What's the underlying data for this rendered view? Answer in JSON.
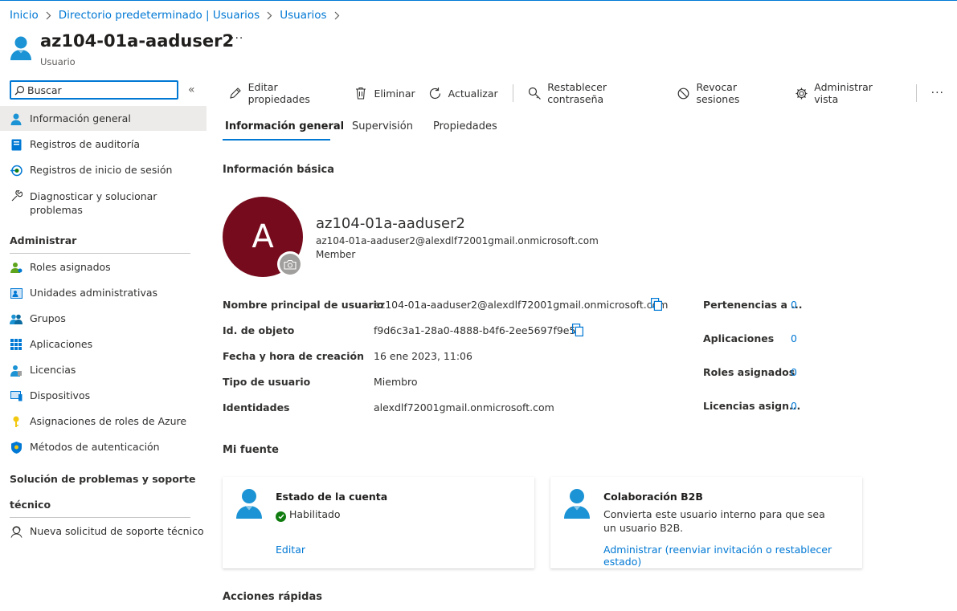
{
  "breadcrumb": {
    "items": [
      "Inicio",
      "Directorio predeterminado | Usuarios",
      "Usuarios"
    ]
  },
  "header": {
    "title": "az104-01a-aaduser2",
    "subtitle": "Usuario",
    "more_label": "···"
  },
  "sidebar": {
    "search_placeholder": "Buscar",
    "collapse_label": "«",
    "top_items": [
      {
        "label": "Información general",
        "icon": "user-icon"
      },
      {
        "label": "Registros de auditoría",
        "icon": "audit-log-icon"
      },
      {
        "label": "Registros de inicio de sesión",
        "icon": "sign-in-log-icon"
      },
      {
        "label": "Diagnosticar y solucionar problemas",
        "icon": "wrench-icon"
      }
    ],
    "section_manage": "Administrar",
    "manage_items": [
      {
        "label": "Roles asignados",
        "icon": "assigned-roles-icon"
      },
      {
        "label": "Unidades administrativas",
        "icon": "admin-units-icon"
      },
      {
        "label": "Grupos",
        "icon": "groups-icon"
      },
      {
        "label": "Aplicaciones",
        "icon": "applications-icon"
      },
      {
        "label": "Licencias",
        "icon": "licenses-icon"
      },
      {
        "label": "Dispositivos",
        "icon": "devices-icon"
      },
      {
        "label": "Asignaciones de roles de Azure",
        "icon": "key-icon"
      },
      {
        "label": "Métodos de autenticación",
        "icon": "shield-icon"
      }
    ],
    "section_support_line1": "Solución de problemas y soporte",
    "section_support_line2": "técnico",
    "support_items": [
      {
        "label": "Nueva solicitud de soporte técnico",
        "icon": "support-person-icon"
      }
    ]
  },
  "toolbar": {
    "edit_label": "Editar propiedades",
    "delete_label": "Eliminar",
    "refresh_label": "Actualizar",
    "reset_password_label": "Restablecer contraseña",
    "revoke_label": "Revocar sesiones",
    "manage_view_label": "Administrar vista",
    "more_label": "···"
  },
  "tabs": [
    "Información general",
    "Supervisión",
    "Propiedades"
  ],
  "basic_info": {
    "section_title": "Información básica",
    "avatar_initial": "A",
    "avatar_color": "#750b1c",
    "display_name": "az104-01a-aaduser2",
    "upn": "az104-01a-aaduser2@alexdlf72001gmail.onmicrosoft.com",
    "member_type": "Member"
  },
  "properties": [
    {
      "label": "Nombre principal de usuario",
      "value": "az104-01a-aaduser2@alexdlf72001gmail.onmicrosoft.com"
    },
    {
      "label": "Id. de objeto",
      "value": "f9d6c3a1-28a0-4888-b4f6-2ee5697f9e5e"
    },
    {
      "label": "Fecha y hora de creación",
      "value": "16 ene 2023, 11:06"
    },
    {
      "label": "Tipo de usuario",
      "value": "Miembro"
    },
    {
      "label": "Identidades",
      "value": "alexdlf72001gmail.onmicrosoft.com"
    }
  ],
  "stats": [
    {
      "label": "Pertenencias a ...",
      "value": "0"
    },
    {
      "label": "Aplicaciones",
      "value": "0"
    },
    {
      "label": "Roles asignados",
      "value": "0"
    },
    {
      "label": "Licencias asign...",
      "value": "0"
    }
  ],
  "feed": {
    "section_title": "Mi fuente",
    "account_card": {
      "title": "Estado de la cuenta",
      "status": "Habilitado",
      "link": "Editar"
    },
    "b2b_card": {
      "title": "Colaboración B2B",
      "body": "Convierta este usuario interno para que sea un usuario B2B.",
      "link": "Administrar (reenviar invitación o restablecer estado)"
    }
  },
  "quick_actions": {
    "section_title": "Acciones rápidas"
  },
  "colors": {
    "accent": "#0078d4",
    "success": "#107c10",
    "avatar": "#750b1c"
  }
}
